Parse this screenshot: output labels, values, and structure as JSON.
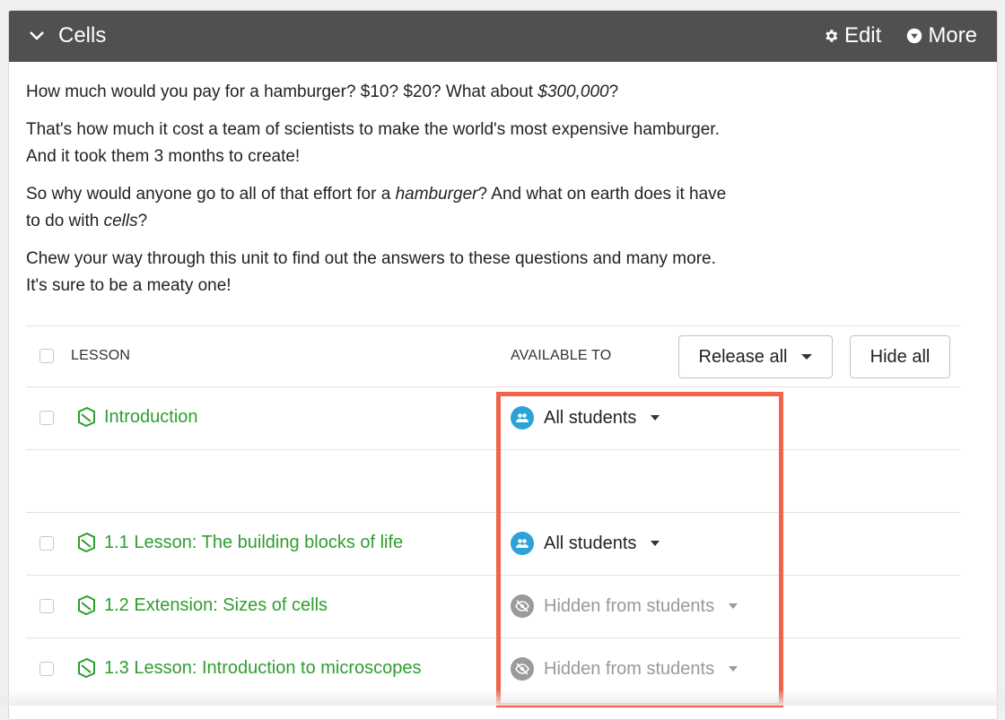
{
  "header": {
    "title": "Cells",
    "edit_label": "Edit",
    "more_label": "More"
  },
  "intro": {
    "p1_pre": "How much would you pay for a hamburger? $10? $20? What about ",
    "p1_em": "$300,000",
    "p1_post": "?",
    "p2_line1": "That's how much it cost a team of scientists to make the world's most expensive hamburger.",
    "p2_line2": "And it took them 3 months to create!",
    "p3_pre": "So why would anyone go to all of that effort for a ",
    "p3_em1": "hamburger",
    "p3_mid": "? And what on earth does it have",
    "p3_line2_pre": "to do with ",
    "p3_em2": "cells",
    "p3_post": "?",
    "p4_line1": "Chew your way through this unit to find out the answers to these questions and many more.",
    "p4_line2": "It's sure to be a meaty one!"
  },
  "table": {
    "col_lesson": "LESSON",
    "col_available": "AVAILABLE TO",
    "release_all_label": "Release all",
    "hide_all_label": "Hide all",
    "rows": [
      {
        "title": "Introduction",
        "availability": "All students"
      },
      {
        "title": "",
        "availability": ""
      },
      {
        "title": "1.1 Lesson: The building blocks of life",
        "availability": "All students"
      },
      {
        "title": "1.2 Extension: Sizes of cells",
        "availability": "Hidden from students"
      },
      {
        "title": "1.3 Lesson: Introduction to microscopes",
        "availability": "Hidden from students"
      }
    ]
  },
  "colors": {
    "header_bg": "#505050",
    "link_green": "#2e9e2e",
    "avail_blue": "#2ba3d6",
    "hidden_grey": "#9a9a9a",
    "highlight_red": "#f2634c"
  }
}
